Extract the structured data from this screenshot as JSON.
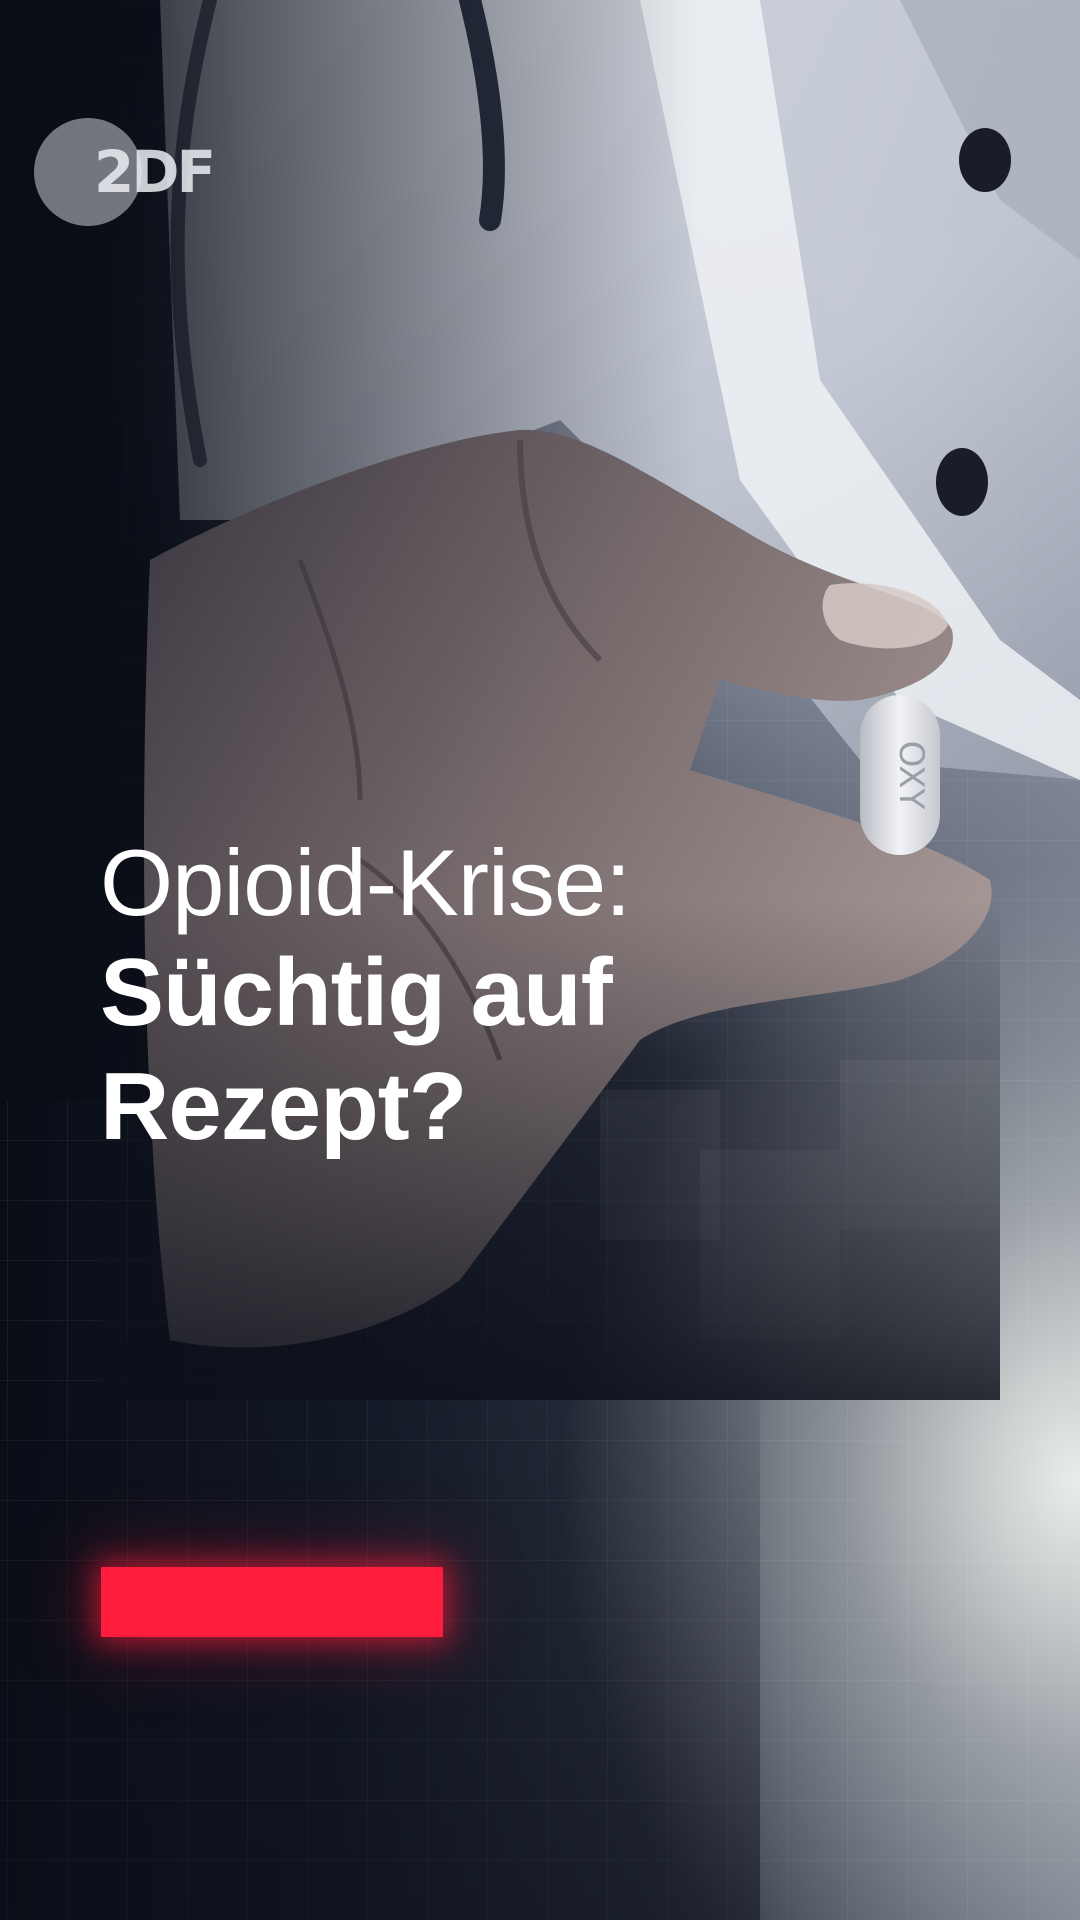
{
  "logo": {
    "text": "2DF"
  },
  "headline": {
    "line1": "Opioid-Krise:",
    "line2a": "Süchtig auf",
    "line2b": "Rezept?"
  },
  "pill": {
    "imprint": "OXY"
  },
  "colors": {
    "accent": "#ff1d3d",
    "background": "#0c101a",
    "text": "#ffffff"
  }
}
